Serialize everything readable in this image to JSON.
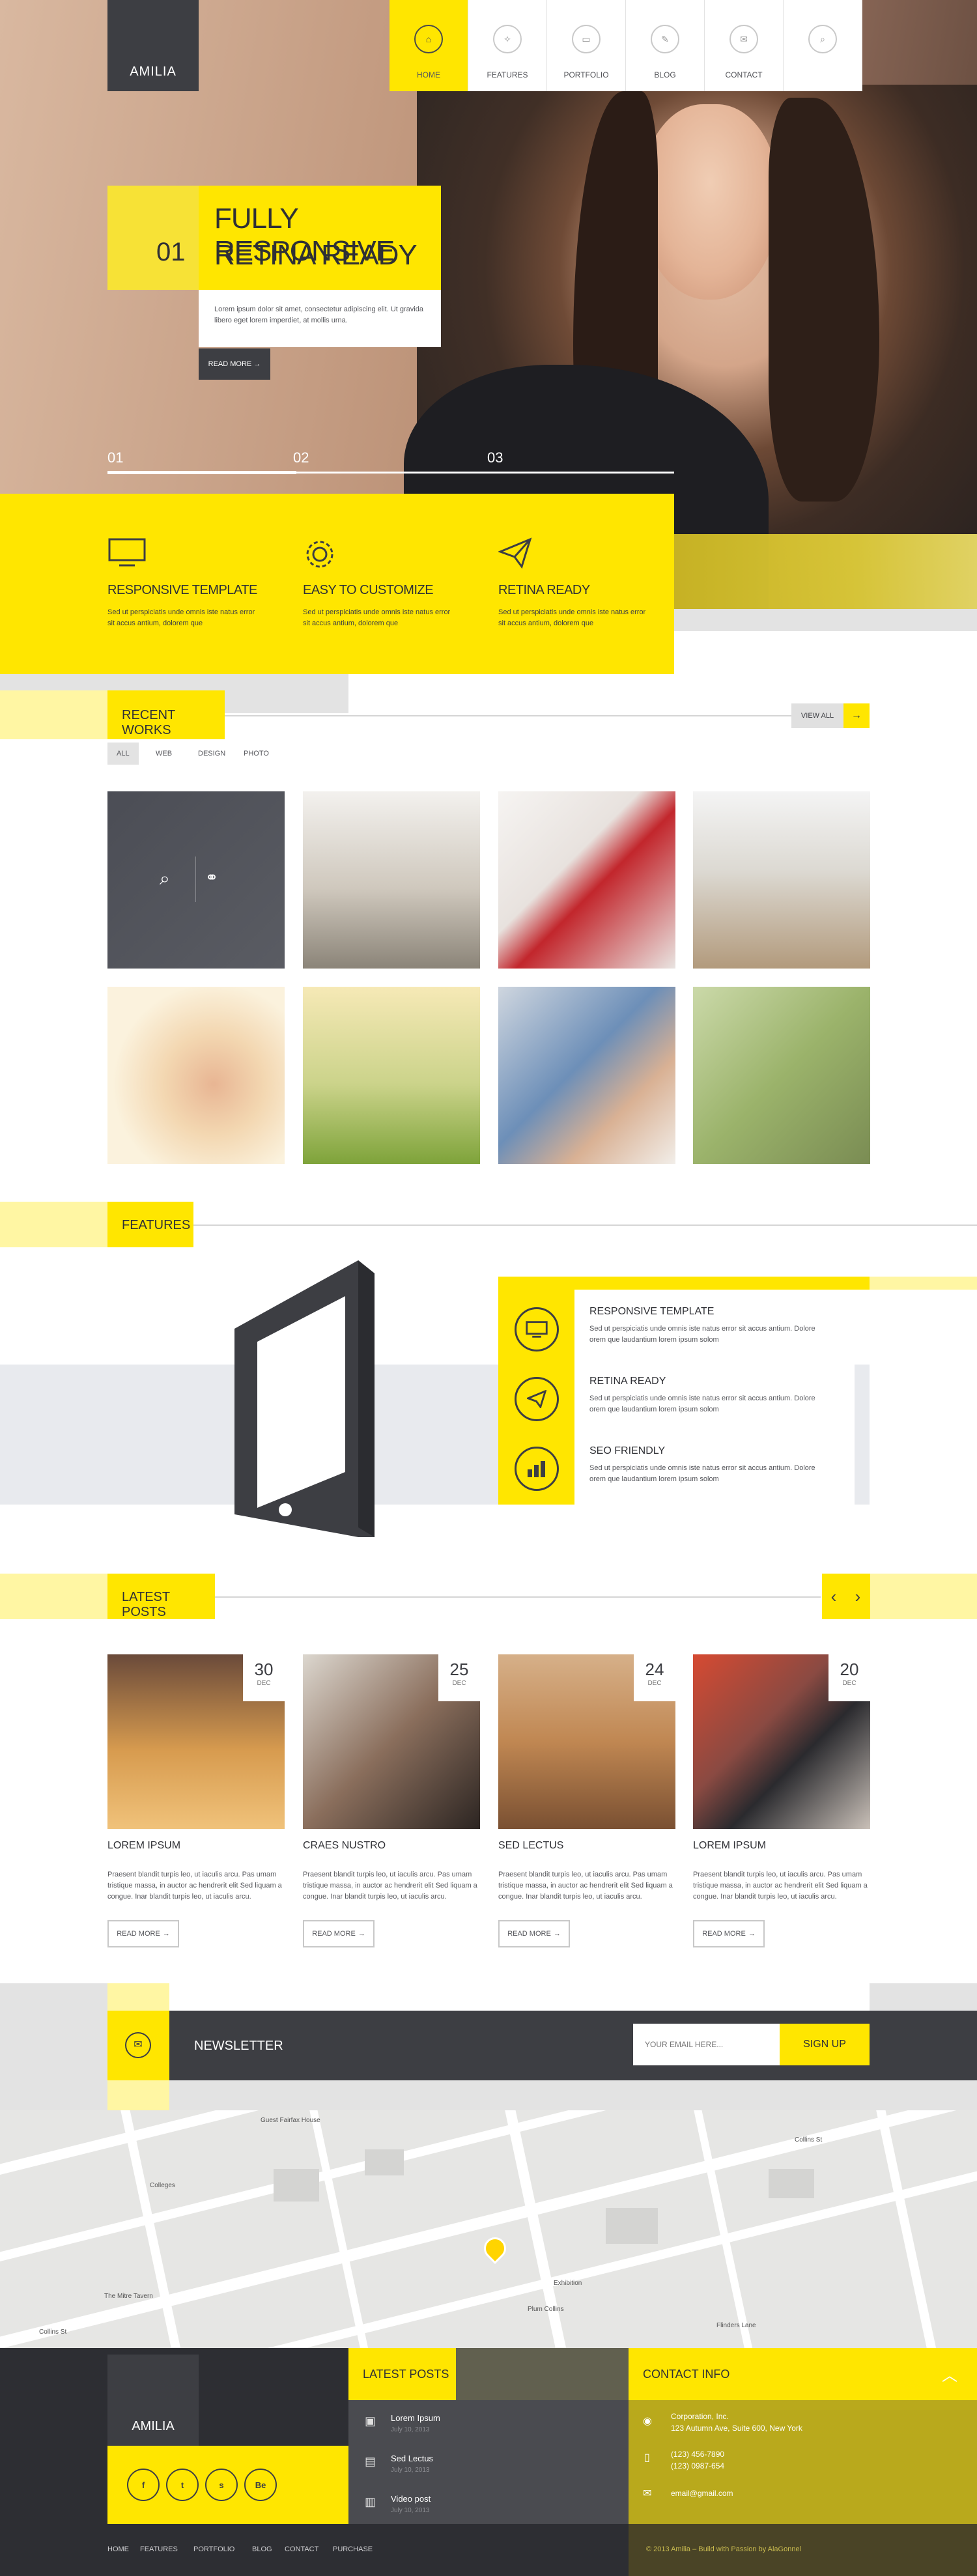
{
  "brand": {
    "logo": "AMILIA"
  },
  "nav": [
    {
      "label": "HOME",
      "icon": "home-icon",
      "glyph": "⌂"
    },
    {
      "label": "FEATURES",
      "icon": "lightbulb-icon",
      "glyph": "✧"
    },
    {
      "label": "PORTFOLIO",
      "icon": "briefcase-icon",
      "glyph": "▭"
    },
    {
      "label": "BLOG",
      "icon": "pencil-icon",
      "glyph": "✎"
    },
    {
      "label": "CONTACT",
      "icon": "envelope-icon",
      "glyph": "✉"
    },
    {
      "label": "",
      "icon": "search-icon",
      "glyph": "⌕"
    }
  ],
  "hero": {
    "number": "01",
    "title_line1": "FULLY RESPONSIVE",
    "title_line2": "RETINA READY",
    "text": "Lorem ipsum dolor sit amet, consectetur adipiscing elit. Ut gravida libero eget lorem imperdiet, at mollis urna.",
    "button": "READ MORE",
    "slides": [
      "01",
      "02",
      "03"
    ]
  },
  "features_strip": [
    {
      "title": "RESPONSIVE TEMPLATE",
      "icon": "monitor-icon",
      "text": "Sed ut perspiciatis unde omnis iste natus error sit accus antium, dolorem que"
    },
    {
      "title": "EASY TO CUSTOMIZE",
      "icon": "gear-icon",
      "text": "Sed ut perspiciatis unde omnis iste natus error sit accus antium, dolorem que"
    },
    {
      "title": "RETINA READY",
      "icon": "paper-plane-icon",
      "text": "Sed ut perspiciatis unde omnis iste natus error sit accus antium, dolorem que"
    }
  ],
  "recent_works": {
    "title": "RECENT WORKS",
    "view_all": "VIEW ALL",
    "filters": [
      "ALL",
      "WEB",
      "DESIGN",
      "PHOTO"
    ]
  },
  "features": {
    "title": "FEATURES",
    "items": [
      {
        "title": "RESPONSIVE TEMPLATE",
        "icon": "monitor-icon",
        "text": "Sed ut perspiciatis unde omnis iste natus error sit accus antium. Dolore orem que laudantium lorem ipsum solom"
      },
      {
        "title": "RETINA READY",
        "icon": "paper-plane-icon",
        "text": "Sed ut perspiciatis unde omnis iste natus error sit accus antium. Dolore orem que laudantium lorem ipsum solom"
      },
      {
        "title": "SEO FRIENDLY",
        "icon": "chart-icon",
        "text": "Sed ut perspiciatis unde omnis iste natus error sit accus antium. Dolore orem que laudantium lorem ipsum solom"
      }
    ]
  },
  "latest_posts": {
    "title": "LATEST POSTS",
    "prev": "‹",
    "next": "›",
    "posts": [
      {
        "day": "30",
        "month": "DEC",
        "title": "LOREM IPSUM",
        "text": "Praesent blandit turpis leo, ut iaculis arcu. Pas umam tristique massa, in auctor ac hendrerit elit Sed liquam a congue. Inar blandit turpis leo, ut iaculis arcu.",
        "button": "READ MORE"
      },
      {
        "day": "25",
        "month": "DEC",
        "title": "CRAES NUSTRO",
        "text": "Praesent blandit turpis leo, ut iaculis arcu. Pas umam tristique massa, in auctor ac hendrerit elit Sed liquam a congue. Inar blandit turpis leo, ut iaculis arcu.",
        "button": "READ MORE"
      },
      {
        "day": "24",
        "month": "DEC",
        "title": "SED LECTUS",
        "text": "Praesent blandit turpis leo, ut iaculis arcu. Pas umam tristique massa, in auctor ac hendrerit elit Sed liquam a congue. Inar blandit turpis leo, ut iaculis arcu.",
        "button": "READ MORE"
      },
      {
        "day": "20",
        "month": "DEC",
        "title": "LOREM IPSUM",
        "text": "Praesent blandit turpis leo, ut iaculis arcu. Pas umam tristique massa, in auctor ac hendrerit elit Sed liquam a congue. Inar blandit turpis leo, ut iaculis arcu.",
        "button": "READ MORE"
      }
    ]
  },
  "newsletter": {
    "title": "NEWSLETTER",
    "placeholder": "YOUR EMAIL HERE...",
    "button": "SIGN UP"
  },
  "map": {
    "labels": [
      "Guest Fairfax House",
      "Colleges",
      "Collins St",
      "Flinders Lane",
      "Plum Collins",
      "The Mitre Tavern",
      "Exhibition",
      "Collins St"
    ]
  },
  "footer": {
    "logo": "AMILIA",
    "social": [
      "f",
      "t",
      "s",
      "Be"
    ],
    "latest_title": "LATEST POSTS",
    "latest": [
      {
        "title": "Lorem Ipsum",
        "date": "July 10, 2013",
        "icon": "image-icon"
      },
      {
        "title": "Sed Lectus",
        "date": "July 10, 2013",
        "icon": "document-icon"
      },
      {
        "title": "Video post",
        "date": "July 10, 2013",
        "icon": "film-icon"
      }
    ],
    "contact_title": "CONTACT INFO",
    "contact": {
      "company": "Corporation, Inc.",
      "address": "123 Autumn Ave, Suite 600, New York",
      "phone1": "(123) 456-7890",
      "phone2": "(123) 0987-654",
      "email": "email@gmail.com"
    },
    "bottom_nav": [
      "HOME",
      "FEATURES",
      "PORTFOLIO",
      "BLOG",
      "CONTACT",
      "PURCHASE"
    ],
    "copyright": "© 2013 Amilia – Build with Passion by AlaGonnel"
  },
  "colors": {
    "accent": "#ffe600",
    "dark": "#3d3e43",
    "muted_gold": "#b9a91c"
  }
}
